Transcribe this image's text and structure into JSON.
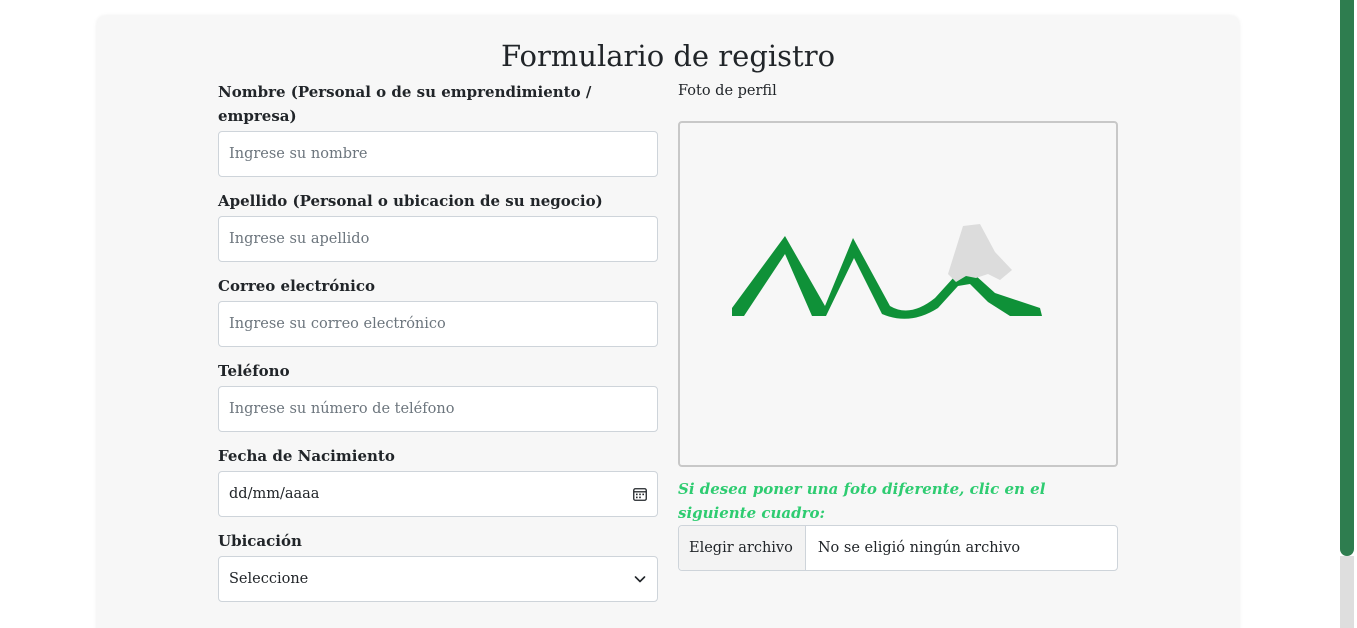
{
  "form": {
    "title": "Formulario de registro",
    "fields": {
      "nombre": {
        "label": "Nombre (Personal o de su emprendimiento / empresa)",
        "placeholder": "Ingrese su nombre"
      },
      "apellido": {
        "label": "Apellido (Personal o ubicacion de su negocio)",
        "placeholder": "Ingrese su apellido"
      },
      "correo": {
        "label": "Correo electrónico",
        "placeholder": "Ingrese su correo electrónico"
      },
      "telefono": {
        "label": "Teléfono",
        "placeholder": "Ingrese su número de teléfono"
      },
      "fecha": {
        "label": "Fecha de Nacimiento",
        "value": "dd/mm/aaaa",
        "icon": "calendar-icon"
      },
      "ubicacion": {
        "label": "Ubicación",
        "selected": "Seleccione",
        "icon": "chevron-down-icon"
      }
    },
    "photo": {
      "label": "Foto de perfil",
      "hint": "Si desea poner una foto diferente, clic en el siguiente cuadro:",
      "file_button": "Elegir archivo",
      "file_status": "No se eligió ningún archivo"
    }
  },
  "colors": {
    "accent_green": "#2ecc71",
    "logo_green": "#0f9138",
    "scrollbar_green": "#2e7d4f",
    "card_bg": "#f7f7f7"
  }
}
